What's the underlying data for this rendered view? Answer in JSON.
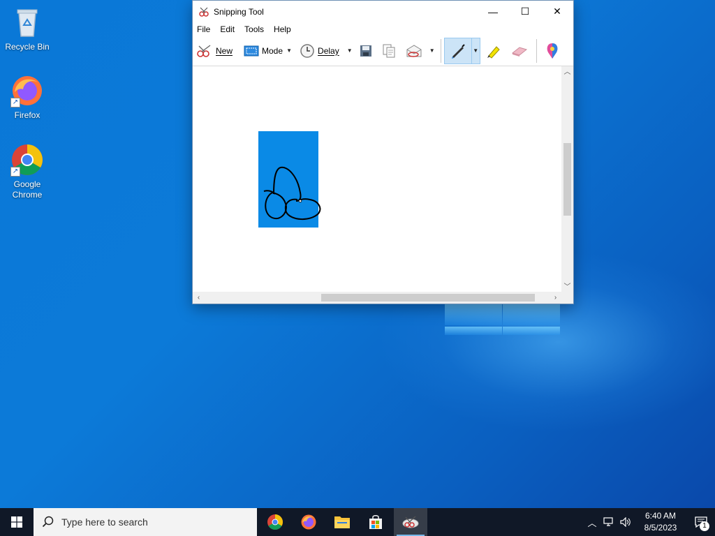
{
  "desktop": {
    "icons": [
      {
        "label": "Recycle Bin",
        "icon": "recycle-bin-icon"
      },
      {
        "label": "Firefox",
        "icon": "firefox-icon"
      },
      {
        "label": "Google Chrome",
        "icon": "chrome-icon"
      }
    ]
  },
  "window": {
    "title": "Snipping Tool",
    "controls": {
      "minimize": "—",
      "maximize": "☐",
      "close": "✕"
    },
    "menu": [
      "File",
      "Edit",
      "Tools",
      "Help"
    ],
    "toolbar": {
      "new_label": "New",
      "mode_label": "Mode",
      "delay_label": "Delay",
      "active_tool": "pen"
    }
  },
  "taskbar": {
    "search_placeholder": "Type here to search",
    "apps": [
      "chrome",
      "firefox",
      "file-explorer",
      "microsoft-store",
      "snipping-tool"
    ],
    "clock": {
      "time": "6:40 AM",
      "date": "8/5/2023"
    },
    "notification_count": "1"
  },
  "colors": {
    "desktop_blue": "#0a78d7",
    "snip_blue": "#0a8ae6",
    "taskbar": "#101827",
    "toolbar_active": "#cce4f7"
  }
}
